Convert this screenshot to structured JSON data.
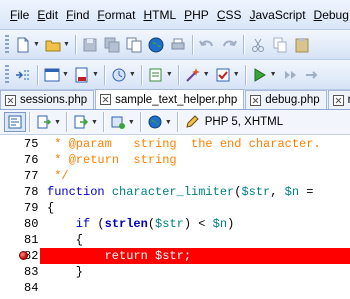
{
  "menubar": {
    "items": [
      {
        "label": "File"
      },
      {
        "label": "Edit"
      },
      {
        "label": "Find"
      },
      {
        "label": "Format"
      },
      {
        "label": "HTML"
      },
      {
        "label": "PHP"
      },
      {
        "label": "CSS"
      },
      {
        "label": "JavaScript"
      },
      {
        "label": "Debug"
      }
    ]
  },
  "tabs": [
    {
      "label": "sessions.php",
      "active": false
    },
    {
      "label": "sample_text_helper.php",
      "active": true
    },
    {
      "label": "debug.php",
      "active": false
    },
    {
      "label": "re",
      "active": false
    }
  ],
  "editor_toolbar": {
    "language_label": "PHP 5, XHTML"
  },
  "code": {
    "lines": [
      {
        "num": "75",
        "tokens": [
          {
            "t": " * ",
            "c": "c-comment"
          },
          {
            "t": "@param   string  the end character.",
            "c": "c-comment"
          }
        ]
      },
      {
        "num": "76",
        "tokens": [
          {
            "t": " * ",
            "c": "c-comment"
          },
          {
            "t": "@return  string",
            "c": "c-comment"
          }
        ]
      },
      {
        "num": "77",
        "tokens": [
          {
            "t": " */",
            "c": "c-comment"
          }
        ]
      },
      {
        "num": "78",
        "tokens": [
          {
            "t": "function ",
            "c": "c-kw"
          },
          {
            "t": "character_limiter",
            "c": "c-func"
          },
          {
            "t": "(",
            "c": "c-plain"
          },
          {
            "t": "$str",
            "c": "c-var"
          },
          {
            "t": ", ",
            "c": "c-plain"
          },
          {
            "t": "$n",
            "c": "c-var"
          },
          {
            "t": " =",
            "c": "c-plain"
          }
        ]
      },
      {
        "num": "79",
        "tokens": [
          {
            "t": "{",
            "c": "c-plain"
          }
        ]
      },
      {
        "num": "80",
        "tokens": [
          {
            "t": "    if ",
            "c": "c-kw"
          },
          {
            "t": "(",
            "c": "c-plain"
          },
          {
            "t": "strlen",
            "c": "c-bold"
          },
          {
            "t": "(",
            "c": "c-plain"
          },
          {
            "t": "$str",
            "c": "c-var"
          },
          {
            "t": ") < ",
            "c": "c-plain"
          },
          {
            "t": "$n",
            "c": "c-var"
          },
          {
            "t": ")",
            "c": "c-plain"
          }
        ]
      },
      {
        "num": "81",
        "tokens": [
          {
            "t": "    {",
            "c": "c-plain"
          }
        ]
      },
      {
        "num": "82",
        "breakpoint": true,
        "tokens": [
          {
            "t": "        return $str;",
            "c": "c-plain"
          }
        ]
      },
      {
        "num": "83",
        "tokens": [
          {
            "t": "    }",
            "c": "c-plain"
          }
        ]
      },
      {
        "num": "84",
        "tokens": [
          {
            "t": "",
            "c": "c-plain"
          }
        ]
      }
    ]
  },
  "colors": {
    "breakpoint": "#ff0000",
    "comment": "#ff8000",
    "keyword": "#0000c0"
  }
}
